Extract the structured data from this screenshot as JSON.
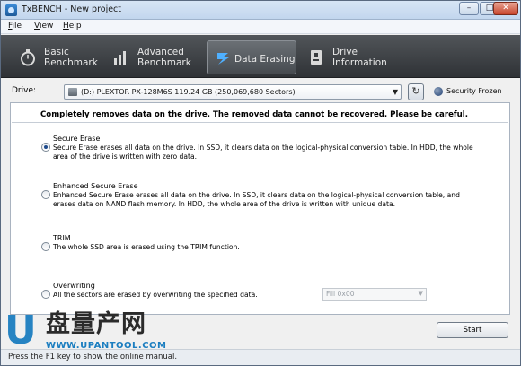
{
  "window": {
    "title": "TxBENCH - New project",
    "minimize": "–",
    "maximize": "□",
    "close": "✕"
  },
  "menu": {
    "items": [
      {
        "label": "File",
        "underline": "F",
        "rest": "ile"
      },
      {
        "label": "View",
        "underline": "V",
        "rest": "iew"
      },
      {
        "label": "Help",
        "underline": "H",
        "rest": "elp"
      }
    ]
  },
  "toolbar": {
    "tabs": [
      {
        "label": "Basic\nBenchmark",
        "icon": "stopwatch-icon",
        "active": false
      },
      {
        "label": "Advanced\nBenchmark",
        "icon": "bar-chart-icon",
        "active": false
      },
      {
        "label": "Data Erasing",
        "icon": "erase-icon",
        "active": true
      },
      {
        "label": "Drive\nInformation",
        "icon": "drive-info-icon",
        "active": false
      }
    ]
  },
  "drive": {
    "label": "Drive:",
    "selected": "(D:) PLEXTOR PX-128M6S  119.24 GB (250,069,680 Sectors)",
    "status": "Security Frozen"
  },
  "warning": "Completely removes data on the drive. The removed data cannot be recovered. Please be careful.",
  "options": [
    {
      "title": "Secure Erase",
      "checked": true,
      "desc": "Secure Erase erases all data on the drive. In SSD, it clears data on the logical-physical conversion table. In HDD, the whole area of the drive is written with zero data."
    },
    {
      "title": "Enhanced Secure Erase",
      "checked": false,
      "desc": "Enhanced Secure Erase erases all data on the drive. In SSD, it clears data on the logical-physical conversion table, and erases data on NAND flash memory. In HDD, the whole area of the drive is written with unique data."
    },
    {
      "title": "TRIM",
      "checked": false,
      "desc": "The whole SSD area is erased using the TRIM function."
    },
    {
      "title": "Overwriting",
      "checked": false,
      "desc": "All the sectors are erased by overwriting the specified data."
    }
  ],
  "fill_select": "Fill 0x00",
  "start_label": "Start",
  "status_text": "Press the F1 key to show the online manual.",
  "watermark": {
    "logo_letter": "U",
    "chinese": "盘量产网",
    "url": "WWW.UPANTOOL.COM"
  }
}
